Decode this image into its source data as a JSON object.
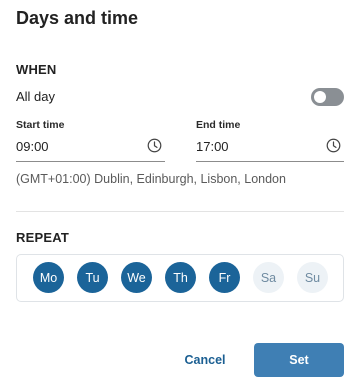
{
  "dialog": {
    "title": "Days and time"
  },
  "when": {
    "heading": "WHEN",
    "all_day": {
      "label": "All day",
      "enabled": false
    },
    "start": {
      "label": "Start time",
      "value": "09:00"
    },
    "end": {
      "label": "End time",
      "value": "17:00"
    },
    "timezone": "(GMT+01:00) Dublin, Edinburgh, Lisbon, London"
  },
  "repeat": {
    "heading": "REPEAT",
    "days": [
      {
        "label": "Mo",
        "selected": true
      },
      {
        "label": "Tu",
        "selected": true
      },
      {
        "label": "We",
        "selected": true
      },
      {
        "label": "Th",
        "selected": true
      },
      {
        "label": "Fr",
        "selected": true
      },
      {
        "label": "Sa",
        "selected": false
      },
      {
        "label": "Su",
        "selected": false
      }
    ]
  },
  "actions": {
    "cancel": "Cancel",
    "set": "Set"
  },
  "colors": {
    "selected_day": "#1b6499",
    "unselected_day_bg": "#edf2f6",
    "primary_button": "#3f7fb4",
    "toggle_off": "#8a8f94"
  }
}
